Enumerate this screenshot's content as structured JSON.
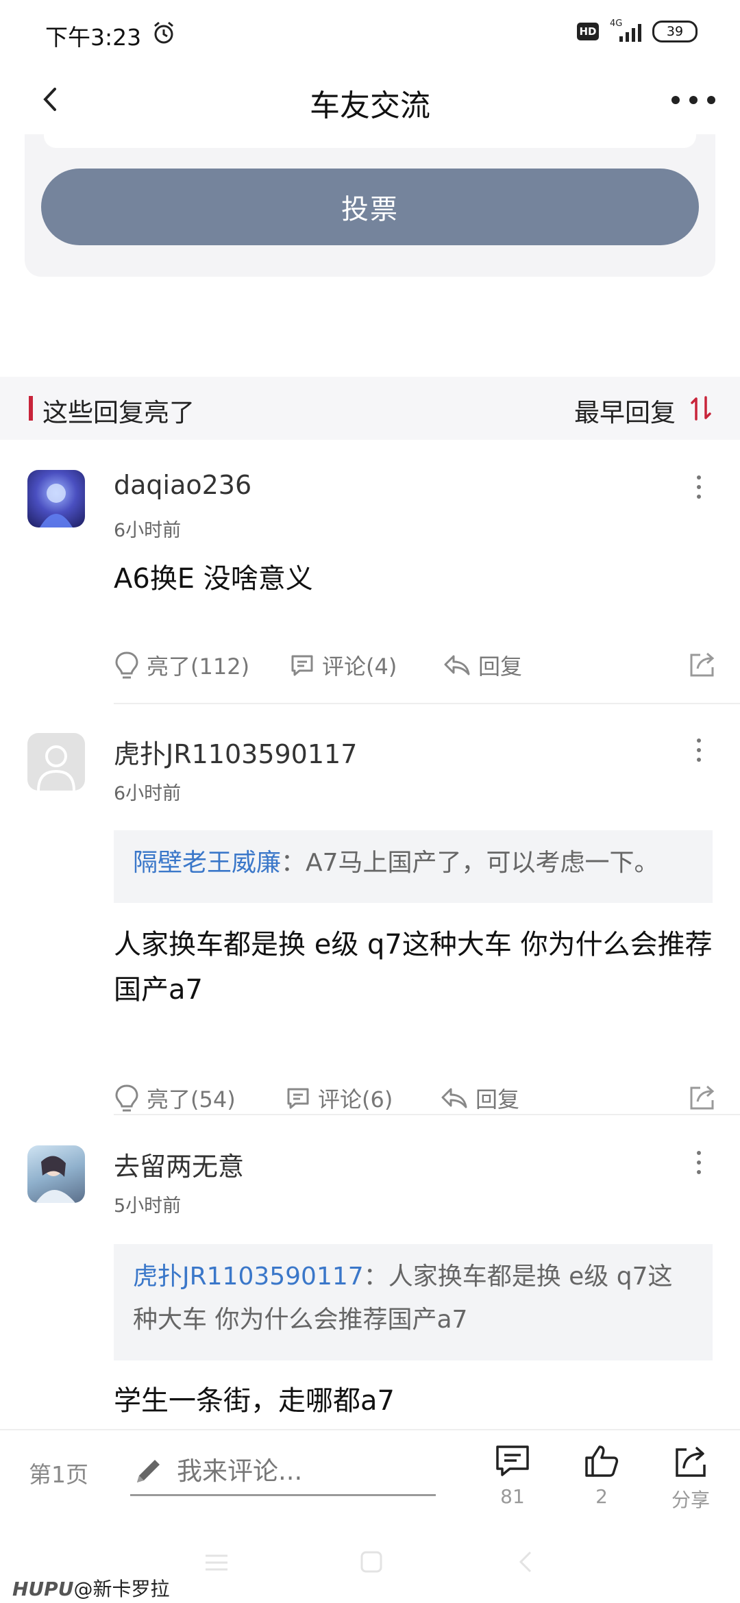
{
  "status": {
    "time": "下午3:23",
    "hd": "HD",
    "network": "4G",
    "battery": "39"
  },
  "nav": {
    "title": "车友交流"
  },
  "vote": {
    "button_label": "投票"
  },
  "section": {
    "title": "这些回复亮了",
    "sort_label": "最早回复"
  },
  "comments": [
    {
      "username": "daqiao236",
      "time": "6小时前",
      "text": "A6换E 没啥意义",
      "light_label": "亮了(112)",
      "comment_label": "评论(4)",
      "reply_label": "回复"
    },
    {
      "username": "虎扑JR1103590117",
      "time": "6小时前",
      "quote_name": "隔壁老王威廉",
      "quote_text": "：A7马上国产了，可以考虑一下。",
      "text": "人家换车都是换 e级 q7这种大车 你为什么会推荐国产a7",
      "light_label": "亮了(54)",
      "comment_label": "评论(6)",
      "reply_label": "回复"
    },
    {
      "username": "去留两无意",
      "time": "5小时前",
      "quote_name": "虎扑JR1103590117",
      "quote_text": "：人家换车都是换 e级 q7这种大车 你为什么会推荐国产a7",
      "text": "学生一条街，走哪都a7"
    }
  ],
  "bottom_bar": {
    "page_label": "第1页",
    "input_placeholder": "我来评论...",
    "comments_count": "81",
    "likes_count": "2",
    "share_label": "分享"
  },
  "watermark": {
    "brand": "HUPU",
    "handle": "@新卡罗拉"
  },
  "colors": {
    "vote_button": "#75849c",
    "accent_red": "#c8243a",
    "link_blue": "#3a77c9"
  }
}
